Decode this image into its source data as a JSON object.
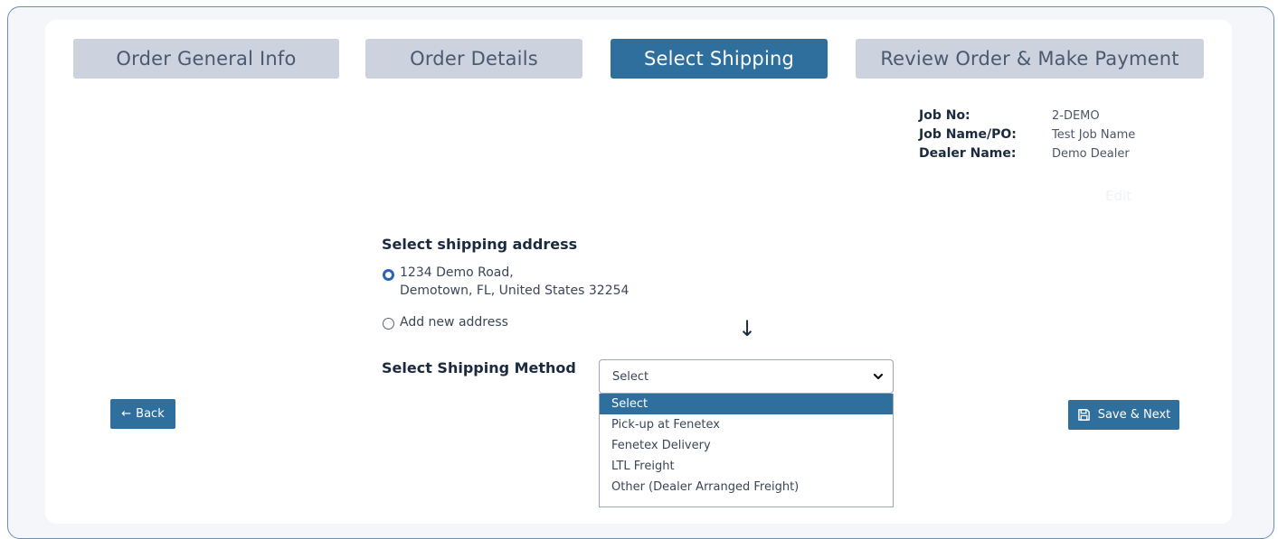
{
  "steps": [
    {
      "label": "Order General Info",
      "active": false
    },
    {
      "label": "Order Details",
      "active": false
    },
    {
      "label": "Select Shipping",
      "active": true
    },
    {
      "label": "Review Order & Make Payment",
      "active": false
    }
  ],
  "job_info": {
    "job_no_label": "Job No:",
    "job_no": "2-DEMO",
    "job_name_label": "Job Name/PO:",
    "job_name": "Test Job Name",
    "dealer_label": "Dealer Name:",
    "dealer": "Demo Dealer",
    "edit_label": "Edit"
  },
  "shipping_address": {
    "title": "Select shipping address",
    "address_line1": "1234 Demo Road,",
    "address_line2": "Demotown, FL, United States 32254",
    "add_new_label": "Add new address"
  },
  "shipping_method": {
    "title": "Select Shipping Method",
    "selected": "Select",
    "options": [
      "Select",
      "Pick-up at Fenetex",
      "Fenetex Delivery",
      "LTL Freight",
      "Other (Dealer Arranged Freight)"
    ]
  },
  "buttons": {
    "back": "Back",
    "save_next": "Save & Next"
  },
  "colors": {
    "accent": "#2f6f9e",
    "step_inactive": "#cdd3de"
  }
}
